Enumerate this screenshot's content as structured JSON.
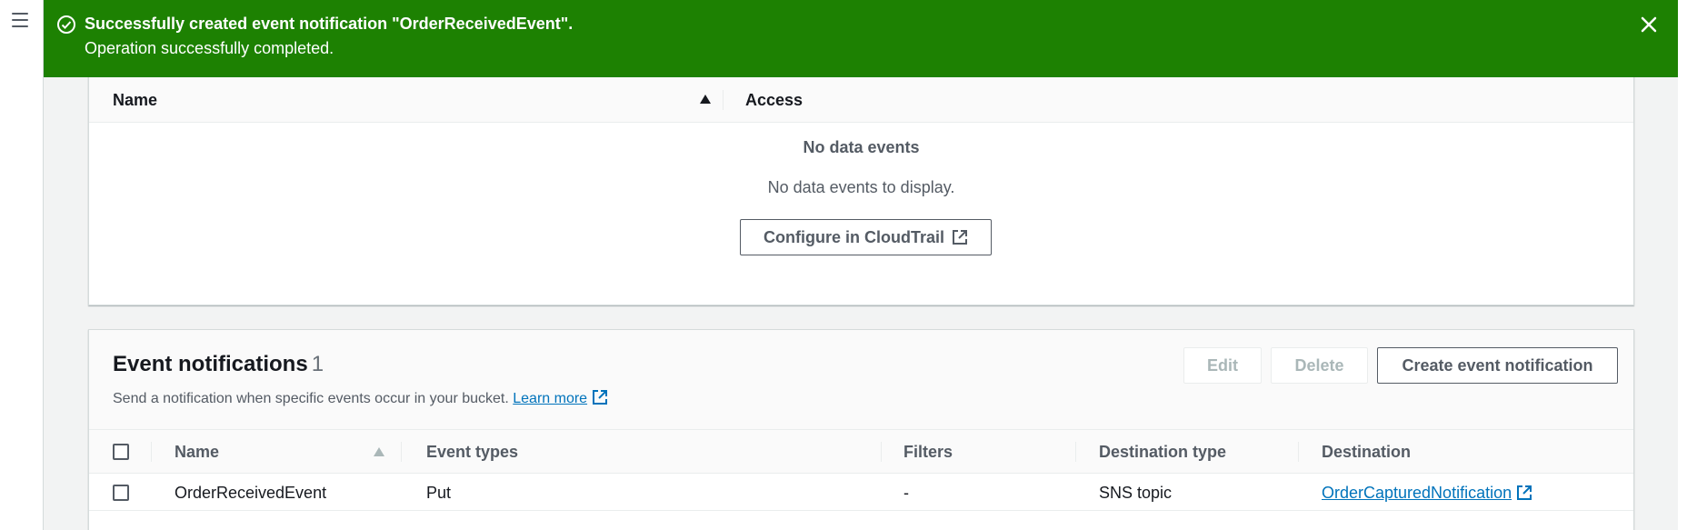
{
  "flash": {
    "title": "Successfully created event notification \"OrderReceivedEvent\".",
    "message": "Operation successfully completed.",
    "color": "#1d8102"
  },
  "data_events": {
    "columns": [
      "Name",
      "Access"
    ],
    "empty_title": "No data events",
    "empty_message": "No data events to display.",
    "configure_button": "Configure in CloudTrail"
  },
  "event_notifications": {
    "title": "Event notifications",
    "count": "1",
    "description": "Send a notification when specific events occur in your bucket.",
    "learn_more": "Learn more",
    "buttons": {
      "edit": "Edit",
      "delete": "Delete",
      "create": "Create event notification"
    },
    "columns": [
      "Name",
      "Event types",
      "Filters",
      "Destination type",
      "Destination"
    ],
    "rows": [
      {
        "name": "OrderReceivedEvent",
        "event_types": "Put",
        "filters": "-",
        "destination_type": "SNS topic",
        "destination": "OrderCapturedNotification"
      }
    ]
  },
  "colors": {
    "success_green": "#1d8102",
    "link_blue": "#0073bb",
    "page_bg": "#f2f3f3"
  }
}
